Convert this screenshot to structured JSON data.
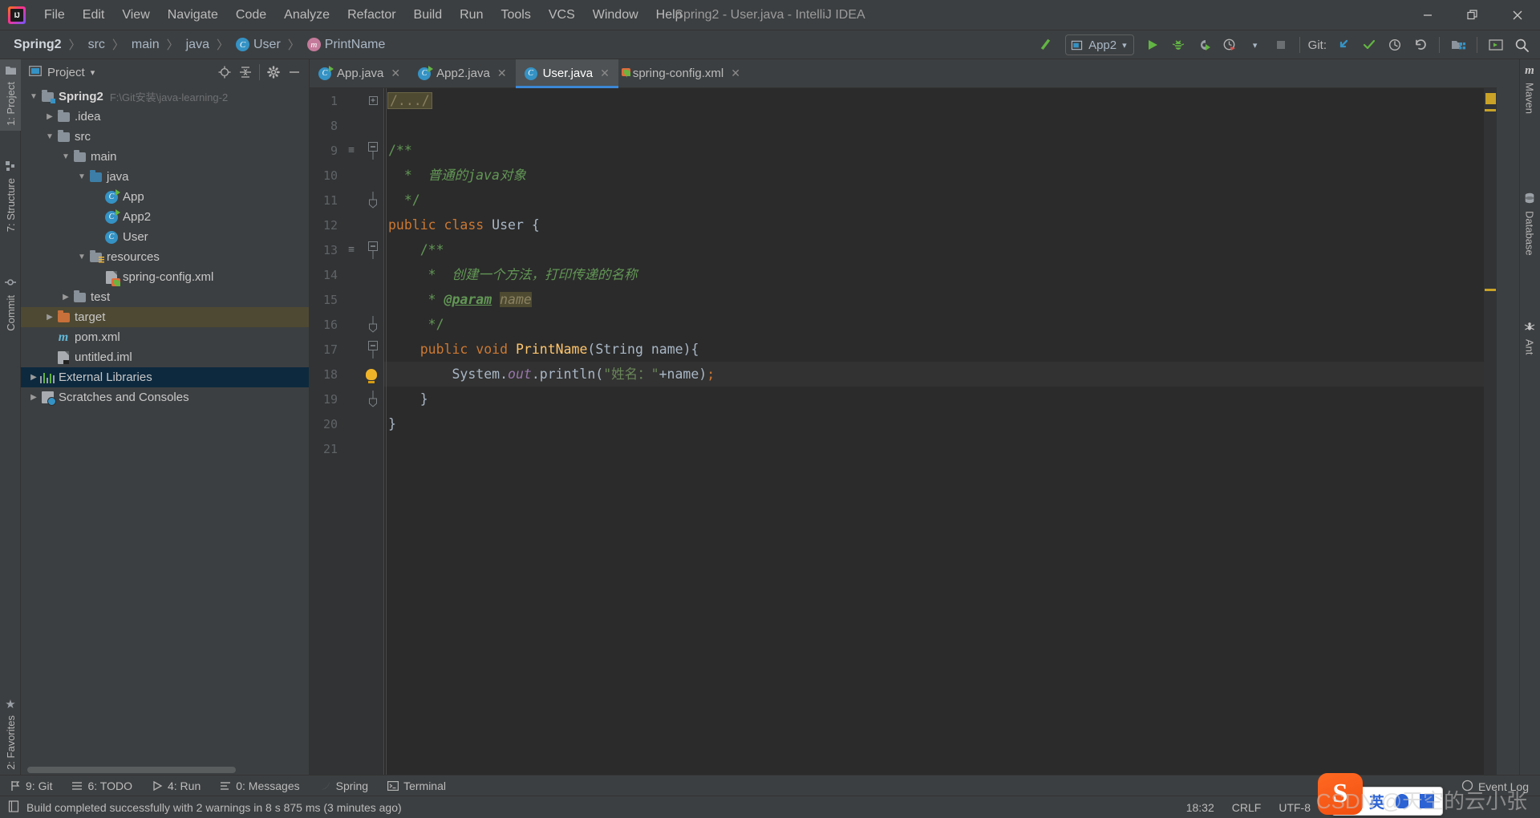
{
  "window": {
    "title": "Spring2 - User.java - IntelliJ IDEA",
    "logo": "intellij-idea-logo",
    "minimize": "−",
    "maximize": "❐",
    "close": "✕"
  },
  "menu": [
    {
      "label": "File",
      "mnemonic": "F"
    },
    {
      "label": "Edit",
      "mnemonic": "E"
    },
    {
      "label": "View",
      "mnemonic": "V"
    },
    {
      "label": "Navigate",
      "mnemonic": "N"
    },
    {
      "label": "Code",
      "mnemonic": "C"
    },
    {
      "label": "Analyze",
      "mnemonic": ""
    },
    {
      "label": "Refactor",
      "mnemonic": "R"
    },
    {
      "label": "Build",
      "mnemonic": "B"
    },
    {
      "label": "Run",
      "mnemonic": "u"
    },
    {
      "label": "Tools",
      "mnemonic": "T"
    },
    {
      "label": "VCS",
      "mnemonic": "S"
    },
    {
      "label": "Window",
      "mnemonic": "W"
    },
    {
      "label": "Help",
      "mnemonic": "H"
    }
  ],
  "breadcrumbs": [
    {
      "label": "Spring2",
      "icon": "none"
    },
    {
      "label": "src",
      "icon": "none"
    },
    {
      "label": "main",
      "icon": "none"
    },
    {
      "label": "java",
      "icon": "none"
    },
    {
      "label": "User",
      "icon": "class-icon"
    },
    {
      "label": "PrintName",
      "icon": "method-icon"
    }
  ],
  "toolbar": {
    "build_icon": "hammer-icon",
    "run_config": "App2",
    "run_config_dropdown": "▾",
    "run": "run-icon",
    "debug": "debug-icon",
    "run_with_coverage": "coverage-icon",
    "profiler": "profiler-icon",
    "profiler_dropdown": "▾",
    "stop": "stop-icon",
    "git_label": "Git:",
    "git_update": "update-project-icon",
    "git_commit": "commit-icon",
    "git_history": "history-icon",
    "git_rollback": "rollback-icon",
    "select_opened_file": "select-opened-file-icon",
    "hide_window": "hide-window-icon",
    "search": "search-everywhere-icon"
  },
  "left_strip": [
    {
      "label": "1: Project",
      "icon": "project-icon",
      "active": true
    },
    {
      "label": "7: Structure",
      "icon": "structure-icon",
      "active": false
    },
    {
      "label": "Commit",
      "icon": "commit-icon",
      "active": false
    },
    {
      "label": "2: Favorites",
      "icon": "star-icon",
      "active": false
    }
  ],
  "right_strip": [
    {
      "label": "Maven",
      "icon": "maven-icon"
    },
    {
      "label": "Database",
      "icon": "database-icon"
    },
    {
      "label": "Ant",
      "icon": "ant-icon"
    }
  ],
  "project_panel": {
    "title": "Project",
    "title_dropdown": "▾",
    "actions": [
      "locate-icon",
      "collapse-all-icon",
      "settings-icon",
      "hide-icon"
    ],
    "tree": [
      {
        "label": "Spring2",
        "path": "F:\\Git安装\\java-learning-2",
        "indent": 0,
        "arrow": "▼",
        "icon": "module-folder",
        "bold": true,
        "state": "none"
      },
      {
        "label": ".idea",
        "path": "",
        "indent": 1,
        "arrow": "▶",
        "icon": "folder",
        "bold": false,
        "state": "none"
      },
      {
        "label": "src",
        "path": "",
        "indent": 1,
        "arrow": "▼",
        "icon": "folder",
        "bold": false,
        "state": "none"
      },
      {
        "label": "main",
        "path": "",
        "indent": 2,
        "arrow": "▼",
        "icon": "folder",
        "bold": false,
        "state": "none"
      },
      {
        "label": "java",
        "path": "",
        "indent": 3,
        "arrow": "▼",
        "icon": "source-folder",
        "bold": false,
        "state": "none"
      },
      {
        "label": "App",
        "path": "",
        "indent": 4,
        "arrow": "",
        "icon": "runnable-class",
        "bold": false,
        "state": "none"
      },
      {
        "label": "App2",
        "path": "",
        "indent": 4,
        "arrow": "",
        "icon": "runnable-class",
        "bold": false,
        "state": "none"
      },
      {
        "label": "User",
        "path": "",
        "indent": 4,
        "arrow": "",
        "icon": "class",
        "bold": false,
        "state": "none"
      },
      {
        "label": "resources",
        "path": "",
        "indent": 3,
        "arrow": "▼",
        "icon": "resource-folder",
        "bold": false,
        "state": "none"
      },
      {
        "label": "spring-config.xml",
        "path": "",
        "indent": 4,
        "arrow": "",
        "icon": "spring-xml",
        "bold": false,
        "state": "none"
      },
      {
        "label": "test",
        "path": "",
        "indent": 2,
        "arrow": "▶",
        "icon": "folder",
        "bold": false,
        "state": "none"
      },
      {
        "label": "target",
        "path": "",
        "indent": 1,
        "arrow": "▶",
        "icon": "excluded-folder",
        "bold": false,
        "state": "highlight"
      },
      {
        "label": "pom.xml",
        "path": "",
        "indent": 1,
        "arrow": "",
        "icon": "maven-pom",
        "bold": false,
        "state": "none"
      },
      {
        "label": "untitled.iml",
        "path": "",
        "indent": 1,
        "arrow": "",
        "icon": "iml-file",
        "bold": false,
        "state": "none"
      },
      {
        "label": "External Libraries",
        "path": "",
        "indent": 0,
        "arrow": "▶",
        "icon": "libraries",
        "bold": false,
        "state": "selected"
      },
      {
        "label": "Scratches and Consoles",
        "path": "",
        "indent": 0,
        "arrow": "▶",
        "icon": "scratches",
        "bold": false,
        "state": "none"
      }
    ]
  },
  "editor": {
    "tabs": [
      {
        "label": "App.java",
        "icon": "runnable-class",
        "active": false,
        "close": "✕"
      },
      {
        "label": "App2.java",
        "icon": "runnable-class",
        "active": false,
        "close": "✕"
      },
      {
        "label": "User.java",
        "icon": "class",
        "active": true,
        "close": "✕"
      },
      {
        "label": "spring-config.xml",
        "icon": "spring-xml",
        "active": false,
        "close": "✕"
      }
    ],
    "lines": [
      {
        "num": "1",
        "fold": "plus",
        "mark": "",
        "bulb": false,
        "cursor": false,
        "tokens": [
          {
            "t": "/.../",
            "c": "folded"
          }
        ]
      },
      {
        "num": "8",
        "fold": "",
        "mark": "",
        "bulb": false,
        "cursor": false,
        "tokens": []
      },
      {
        "num": "9",
        "fold": "start",
        "mark": "doc",
        "bulb": false,
        "cursor": false,
        "tokens": [
          {
            "t": "/**",
            "c": "cmt-plain"
          }
        ]
      },
      {
        "num": "10",
        "fold": "",
        "mark": "",
        "bulb": false,
        "cursor": false,
        "tokens": [
          {
            "t": "  *  普通的java对象",
            "c": "cmt"
          }
        ]
      },
      {
        "num": "11",
        "fold": "end",
        "mark": "",
        "bulb": false,
        "cursor": false,
        "tokens": [
          {
            "t": "  */",
            "c": "cmt-plain"
          }
        ]
      },
      {
        "num": "12",
        "fold": "",
        "mark": "",
        "bulb": false,
        "cursor": false,
        "tokens": [
          {
            "t": "public class ",
            "c": "kw"
          },
          {
            "t": "User ",
            "c": "cls"
          },
          {
            "t": "{",
            "c": "plain"
          }
        ]
      },
      {
        "num": "13",
        "fold": "start",
        "mark": "doc",
        "bulb": false,
        "cursor": false,
        "tokens": [
          {
            "t": "    /**",
            "c": "cmt-plain"
          }
        ]
      },
      {
        "num": "14",
        "fold": "",
        "mark": "",
        "bulb": false,
        "cursor": false,
        "tokens": [
          {
            "t": "     *  创建一个方法，打印传递的名称",
            "c": "cmt"
          }
        ]
      },
      {
        "num": "15",
        "fold": "",
        "mark": "",
        "bulb": false,
        "cursor": false,
        "tokens": [
          {
            "t": "     * ",
            "c": "cmt-plain"
          },
          {
            "t": "@param",
            "c": "tag"
          },
          {
            "t": " ",
            "c": "plain"
          },
          {
            "t": "name",
            "c": "param-hl"
          }
        ]
      },
      {
        "num": "16",
        "fold": "end",
        "mark": "",
        "bulb": false,
        "cursor": false,
        "tokens": [
          {
            "t": "     */",
            "c": "cmt-plain"
          }
        ]
      },
      {
        "num": "17",
        "fold": "start",
        "mark": "",
        "bulb": false,
        "cursor": false,
        "tokens": [
          {
            "t": "    ",
            "c": "plain"
          },
          {
            "t": "public void ",
            "c": "kw"
          },
          {
            "t": "PrintName",
            "c": "meth"
          },
          {
            "t": "(",
            "c": "plain"
          },
          {
            "t": "String",
            "c": "cls"
          },
          {
            "t": " name){",
            "c": "plain"
          }
        ]
      },
      {
        "num": "18",
        "fold": "",
        "mark": "",
        "bulb": true,
        "cursor": true,
        "tokens": [
          {
            "t": "        System.",
            "c": "plain"
          },
          {
            "t": "out",
            "c": "fld"
          },
          {
            "t": ".println(",
            "c": "plain"
          },
          {
            "t": "\"姓名：\"",
            "c": "str"
          },
          {
            "t": "+name)",
            "c": "plain"
          },
          {
            "t": ";",
            "c": "sem"
          }
        ]
      },
      {
        "num": "19",
        "fold": "end",
        "mark": "",
        "bulb": false,
        "cursor": false,
        "tokens": [
          {
            "t": "    }",
            "c": "plain"
          }
        ]
      },
      {
        "num": "20",
        "fold": "",
        "mark": "",
        "bulb": false,
        "cursor": false,
        "tokens": [
          {
            "t": "}",
            "c": "plain"
          }
        ]
      },
      {
        "num": "21",
        "fold": "",
        "mark": "",
        "bulb": false,
        "cursor": false,
        "tokens": []
      }
    ]
  },
  "toolwindow_bar": [
    {
      "label": "9: Git",
      "mnemonic": "9",
      "icon": "git-icon"
    },
    {
      "label": "6: TODO",
      "mnemonic": "6",
      "icon": "todo-icon"
    },
    {
      "label": "4: Run",
      "mnemonic": "4",
      "icon": "run-icon"
    },
    {
      "label": "0: Messages",
      "mnemonic": "0",
      "icon": "messages-icon"
    },
    {
      "label": "Spring",
      "mnemonic": "",
      "icon": "spring-icon"
    },
    {
      "label": "Terminal",
      "mnemonic": "",
      "icon": "terminal-icon"
    }
  ],
  "statusbar": {
    "icon": "info-icon",
    "message": "Build completed successfully with 2 warnings in 8 s 875 ms (3 minutes ago)",
    "time": "18:32",
    "line_separator": "CRLF",
    "encoding": "UTF-8",
    "event_log": "Event Log",
    "event_log_icon": "event-log-icon"
  },
  "overlays": {
    "ime_logo": "S",
    "ime_mode": "英",
    "ime_icons": [
      "mic-icon",
      "keyboard-icon"
    ],
    "watermark": "CSDN @天空的云小张"
  },
  "colors": {
    "accent": "#3b87d5",
    "keyword": "#cc7832",
    "comment": "#629755",
    "string": "#6a8759",
    "method": "#ffc66d",
    "field": "#9876aa",
    "selection": "#0d293e",
    "highlight": "#4e4932",
    "marker": "#c9a227"
  }
}
